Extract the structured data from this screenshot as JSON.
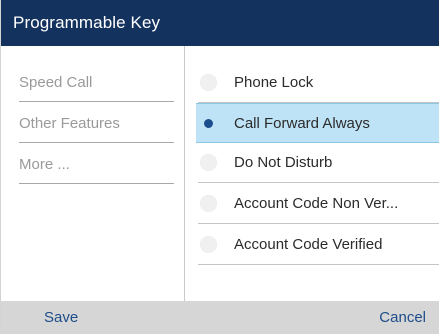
{
  "title": "Programmable Key",
  "categories": [
    {
      "label": "Speed Call"
    },
    {
      "label": "Other Features"
    },
    {
      "label": "More ..."
    }
  ],
  "options": [
    {
      "label": "Phone Lock",
      "selected": false
    },
    {
      "label": "Call Forward Always",
      "selected": true
    },
    {
      "label": "Do Not Disturb",
      "selected": false
    },
    {
      "label": "Account Code Non Ver...",
      "selected": false
    },
    {
      "label": "Account Code Verified",
      "selected": false
    }
  ],
  "softkeys": {
    "left": "Save",
    "right": "Cancel"
  },
  "colors": {
    "titlebar": "#14325e",
    "selection": "#bfe3f6",
    "softkey_text": "#1d4d8a",
    "softkey_bar": "#d6d6d6"
  }
}
